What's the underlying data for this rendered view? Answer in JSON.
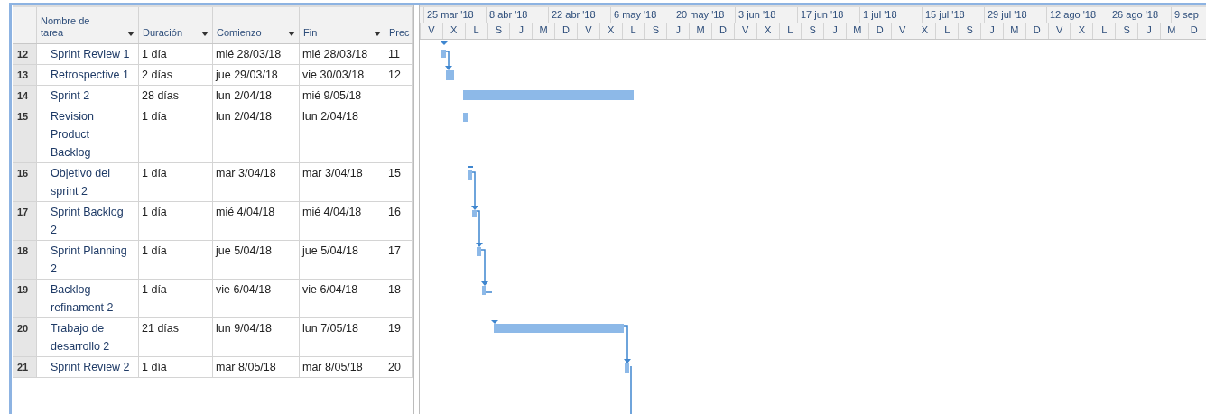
{
  "table": {
    "columns": [
      {
        "label": "Nombre de tarea",
        "dropdown": true
      },
      {
        "label": "Duración",
        "dropdown": true
      },
      {
        "label": "Comienzo",
        "dropdown": true
      },
      {
        "label": "Fin",
        "dropdown": true
      },
      {
        "label": "Prec",
        "dropdown": false
      }
    ],
    "rows": [
      {
        "id": "12",
        "name": "Sprint Review 1",
        "duration": "1 día",
        "start": "mié 28/03/18",
        "finish": "mié 28/03/18",
        "predecessors": "11"
      },
      {
        "id": "13",
        "name": "Retrospective 1",
        "duration": "2 días",
        "start": "jue 29/03/18",
        "finish": "vie 30/03/18",
        "predecessors": "12"
      },
      {
        "id": "14",
        "name": "Sprint 2",
        "duration": "28 días",
        "start": "lun 2/04/18",
        "finish": "mié 9/05/18"
      },
      {
        "id": "15",
        "name": "Revision Product Backlog",
        "duration": "1 día",
        "start": "lun 2/04/18",
        "finish": "lun 2/04/18"
      },
      {
        "id": "16",
        "name": "Objetivo del sprint 2",
        "duration": "1 día",
        "start": "mar 3/04/18",
        "finish": "mar 3/04/18",
        "predecessors": "15"
      },
      {
        "id": "17",
        "name": "Sprint Backlog 2",
        "duration": "1 día",
        "start": "mié 4/04/18",
        "finish": "mié 4/04/18",
        "predecessors": "16"
      },
      {
        "id": "18",
        "name": "Sprint Planning 2",
        "duration": "1 día",
        "start": "jue 5/04/18",
        "finish": "jue 5/04/18",
        "predecessors": "17"
      },
      {
        "id": "19",
        "name": "Backlog refinament 2",
        "duration": "1 día",
        "start": "vie 6/04/18",
        "finish": "vie 6/04/18",
        "predecessors": "18"
      },
      {
        "id": "20",
        "name": "Trabajo de desarrollo 2",
        "duration": "21 días",
        "start": "lun 9/04/18",
        "finish": "lun 7/05/18",
        "predecessors": "19"
      },
      {
        "id": "21",
        "name": "Sprint Review 2",
        "duration": "1 día",
        "start": "mar 8/05/18",
        "finish": "mar 8/05/18",
        "predecessors": "20"
      }
    ]
  },
  "timescale": {
    "top": [
      "25 mar '18",
      "8 abr '18",
      "22 abr '18",
      "6 may '18",
      "20 may '18",
      "3 jun '18",
      "17 jun '18",
      "1 jul '18",
      "15 jul '18",
      "29 jul '18",
      "12 ago '18",
      "26 ago '18",
      "9 sep"
    ],
    "bottom": [
      "V",
      "X",
      "L",
      "S",
      "J",
      "M",
      "D",
      "V",
      "X",
      "L",
      "S",
      "J",
      "M",
      "D",
      "V",
      "X",
      "L",
      "S",
      "J",
      "M",
      "D",
      "V",
      "X",
      "L",
      "S",
      "J",
      "M",
      "D",
      "V",
      "X",
      "L",
      "S",
      "J",
      "M",
      "D"
    ]
  }
}
